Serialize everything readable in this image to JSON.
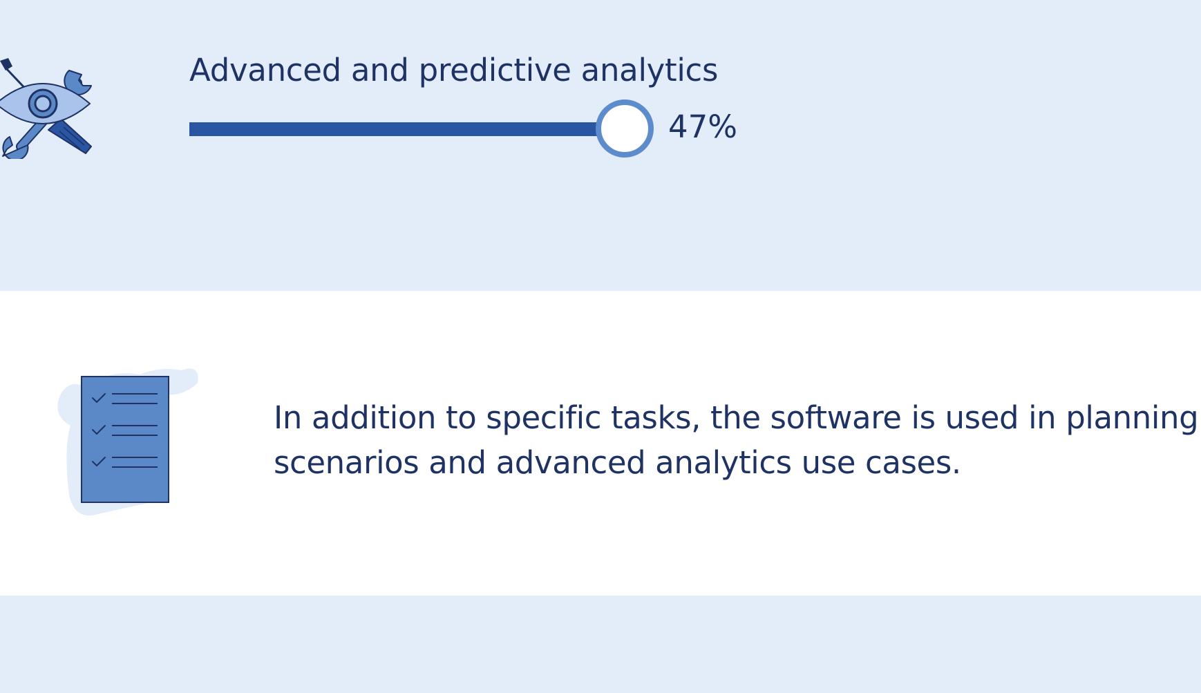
{
  "metric": {
    "icon": "eye-wrench-tools-icon",
    "label": "Advanced and predictive analytics",
    "percent": 47,
    "percent_label": "47%"
  },
  "description": {
    "icon": "checklist-document-icon",
    "lines": [
      "In addition to specific tasks, the software is used in planning",
      "scenarios and advanced analytics use cases."
    ]
  },
  "colors": {
    "band_light": "#e3ecf9",
    "band_white": "#ffffff",
    "text": "#1e3264",
    "bar_fill": "#2955a3",
    "knob_ring": "#5c8ccb",
    "icon_blue": "#5b88c7",
    "icon_light": "#a9c3ea",
    "icon_outline": "#1e3264"
  }
}
